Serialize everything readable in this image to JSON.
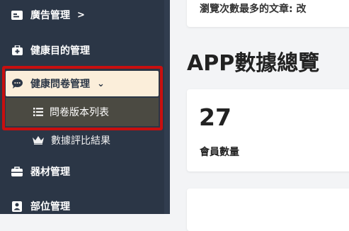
{
  "sidebar": {
    "items": [
      {
        "label": "廣告管理",
        "chevron": ">"
      },
      {
        "label": "健康目的管理"
      },
      {
        "label": "健康問卷管理",
        "chevron": "⌄"
      },
      {
        "label": "問卷版本列表"
      },
      {
        "label": "數據評比結果"
      },
      {
        "label": "器材管理"
      },
      {
        "label": "部位管理"
      }
    ]
  },
  "main": {
    "top_card_text": "瀏覽次數最多的文章: 改",
    "section_title": "APP數據總覽",
    "stat": {
      "value": "27",
      "label": "會員數量"
    }
  },
  "colors": {
    "sidebar_bg": "#2b3646",
    "active_bg": "#fbeeda",
    "submenu_active_bg": "#4b4a42",
    "highlight_border": "#c80f0f",
    "content_bg": "#f3f4f6"
  }
}
